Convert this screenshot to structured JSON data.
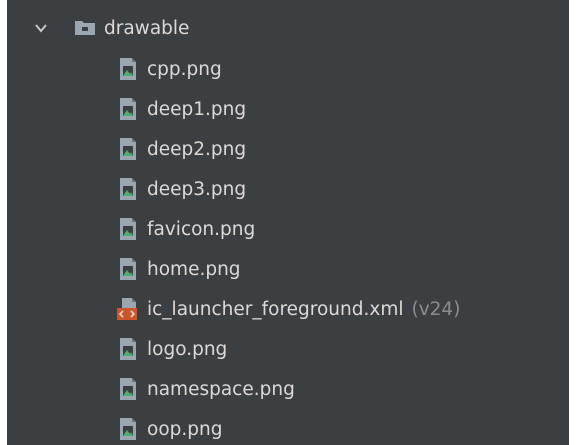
{
  "tree": {
    "folder": {
      "name": "drawable",
      "expanded": true,
      "icon": "folder-icon"
    },
    "files": [
      {
        "name": "cpp.png",
        "type": "image",
        "icon": "image-file-icon"
      },
      {
        "name": "deep1.png",
        "type": "image",
        "icon": "image-file-icon"
      },
      {
        "name": "deep2.png",
        "type": "image",
        "icon": "image-file-icon"
      },
      {
        "name": "deep3.png",
        "type": "image",
        "icon": "image-file-icon"
      },
      {
        "name": "favicon.png",
        "type": "image",
        "icon": "image-file-icon"
      },
      {
        "name": "home.png",
        "type": "image",
        "icon": "image-file-icon"
      },
      {
        "name": "ic_launcher_foreground.xml",
        "suffix": "(v24)",
        "type": "xml",
        "icon": "xml-file-icon"
      },
      {
        "name": "logo.png",
        "type": "image",
        "icon": "image-file-icon"
      },
      {
        "name": "namespace.png",
        "type": "image",
        "icon": "image-file-icon"
      },
      {
        "name": "oop.png",
        "type": "image",
        "icon": "image-file-icon"
      }
    ]
  },
  "colors": {
    "panel_bg": "#3c3f41",
    "text": "#dadada",
    "muted_text": "#8b8e90",
    "image_icon_green": "#4fae72",
    "xml_icon_orange": "#c9572b"
  }
}
